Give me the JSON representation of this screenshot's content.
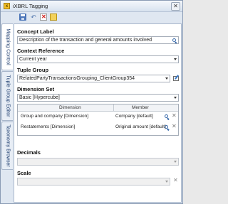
{
  "window": {
    "title": "iXBRL Tagging",
    "app_icon": "ix-app-icon"
  },
  "toolbar": {
    "buttons": [
      {
        "name": "save-icon"
      },
      {
        "name": "undo-icon"
      },
      {
        "name": "delete-icon"
      },
      {
        "name": "note-icon"
      }
    ]
  },
  "side_tabs": [
    {
      "label": "Mapping Control",
      "active": true
    },
    {
      "label": "Tuple Group Editor",
      "active": false
    },
    {
      "label": "Taxonomy Browser",
      "active": false
    }
  ],
  "concept": {
    "label": "Concept Label",
    "value": "Description of the transaction and general amounts involved"
  },
  "context": {
    "label": "Context Reference",
    "value": "Current year"
  },
  "tuple": {
    "label": "Tuple Group",
    "value": "RelatedPartyTransactionsGrouping_ClientGroup354"
  },
  "dimension_set": {
    "label": "Dimension Set",
    "value": "Basic [Hypercube]"
  },
  "dimensions_table": {
    "columns": [
      "Dimension",
      "Member"
    ],
    "rows": [
      {
        "dimension": "Group and company [Dimension]",
        "member": "Company [default]"
      },
      {
        "dimension": "Restatements [Dimension]",
        "member": "Original amount [default]"
      }
    ]
  },
  "decimals": {
    "label": "Decimals",
    "value": ""
  },
  "scale": {
    "label": "Scale",
    "value": ""
  },
  "colors": {
    "accent": "#3466a8",
    "panel_bg": "#ffffff",
    "frame_bg": "#dfe7f1"
  }
}
